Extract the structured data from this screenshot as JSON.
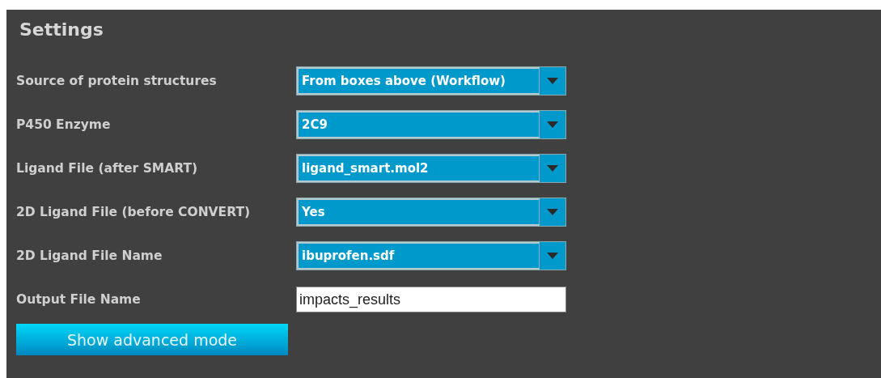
{
  "panel": {
    "title": "Settings"
  },
  "fields": [
    {
      "label": "Source of protein structures",
      "kind": "dropdown",
      "value": "From boxes above (Workflow)"
    },
    {
      "label": "P450 Enzyme",
      "kind": "dropdown",
      "value": "2C9"
    },
    {
      "label": "Ligand File (after SMART)",
      "kind": "dropdown",
      "value": "ligand_smart.mol2"
    },
    {
      "label": "2D Ligand File (before CONVERT)",
      "kind": "dropdown",
      "value": "Yes"
    },
    {
      "label": "2D Ligand File Name",
      "kind": "dropdown",
      "value": "ibuprofen.sdf"
    },
    {
      "label": "Output File Name",
      "kind": "text",
      "value": "impacts_results"
    }
  ],
  "button": {
    "label": "Show advanced mode"
  }
}
